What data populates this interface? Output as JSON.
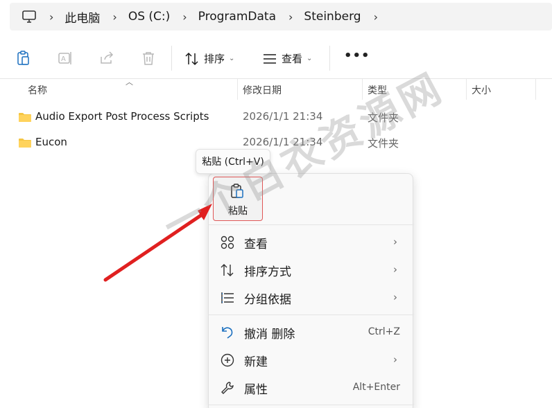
{
  "address_bar": {
    "crumbs": [
      "此电脑",
      "OS (C:)",
      "ProgramData",
      "Steinberg"
    ]
  },
  "toolbar": {
    "sort_label": "排序",
    "view_label": "查看",
    "more_label": "•••"
  },
  "columns": {
    "name": "名称",
    "date": "修改日期",
    "type": "类型",
    "size": "大小"
  },
  "files": [
    {
      "name": "Audio Export Post Process Scripts",
      "date": "2026/1/1 21:34",
      "type": "文件夹"
    },
    {
      "name": "Eucon",
      "date": "2026/1/1 21:34",
      "type": "文件夹"
    }
  ],
  "tooltip": "粘贴 (Ctrl+V)",
  "context_menu": {
    "paste_label": "粘贴",
    "items": [
      {
        "label": "查看",
        "icon": "grid-view-icon",
        "has_submenu": true
      },
      {
        "label": "排序方式",
        "icon": "sort-icon",
        "has_submenu": true
      },
      {
        "label": "分组依据",
        "icon": "group-by-icon",
        "has_submenu": true
      },
      {
        "label": "撤消 删除",
        "icon": "undo-icon",
        "shortcut": "Ctrl+Z"
      },
      {
        "label": "新建",
        "icon": "new-icon",
        "has_submenu": true
      },
      {
        "label": "属性",
        "icon": "properties-wrench-icon",
        "shortcut": "Alt+Enter"
      }
    ],
    "chevron": "›"
  },
  "watermark": "一个白衣资源网",
  "colors": {
    "folder": "#f0c040",
    "annotation_red": "#e02020",
    "accent": "#0067c0"
  }
}
